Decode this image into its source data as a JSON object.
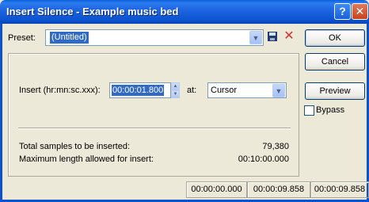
{
  "window": {
    "title": "Insert Silence - Example music bed",
    "help_label": "?",
    "close_label": "✕"
  },
  "preset": {
    "label": "Preset:",
    "value": "(Untitled)"
  },
  "buttons": {
    "ok": "OK",
    "cancel": "Cancel",
    "preview": "Preview"
  },
  "bypass": {
    "label": "Bypass",
    "checked": false
  },
  "insert": {
    "label": "Insert (hr:mn:sc.xxx):",
    "value": "00:00:01.800",
    "at_label": "at:",
    "at_value": "Cursor"
  },
  "stats": {
    "total_label": "Total samples to be inserted:",
    "total_value": "79,380",
    "max_label": "Maximum length allowed for insert:",
    "max_value": "00:10:00.000"
  },
  "status": {
    "start": "00:00:00.000",
    "end": "00:00:09.858",
    "length": "00:00:09.858"
  },
  "icons": {
    "save": "floppy-icon",
    "delete": "delete-icon",
    "combo": "chevron-down-icon"
  }
}
